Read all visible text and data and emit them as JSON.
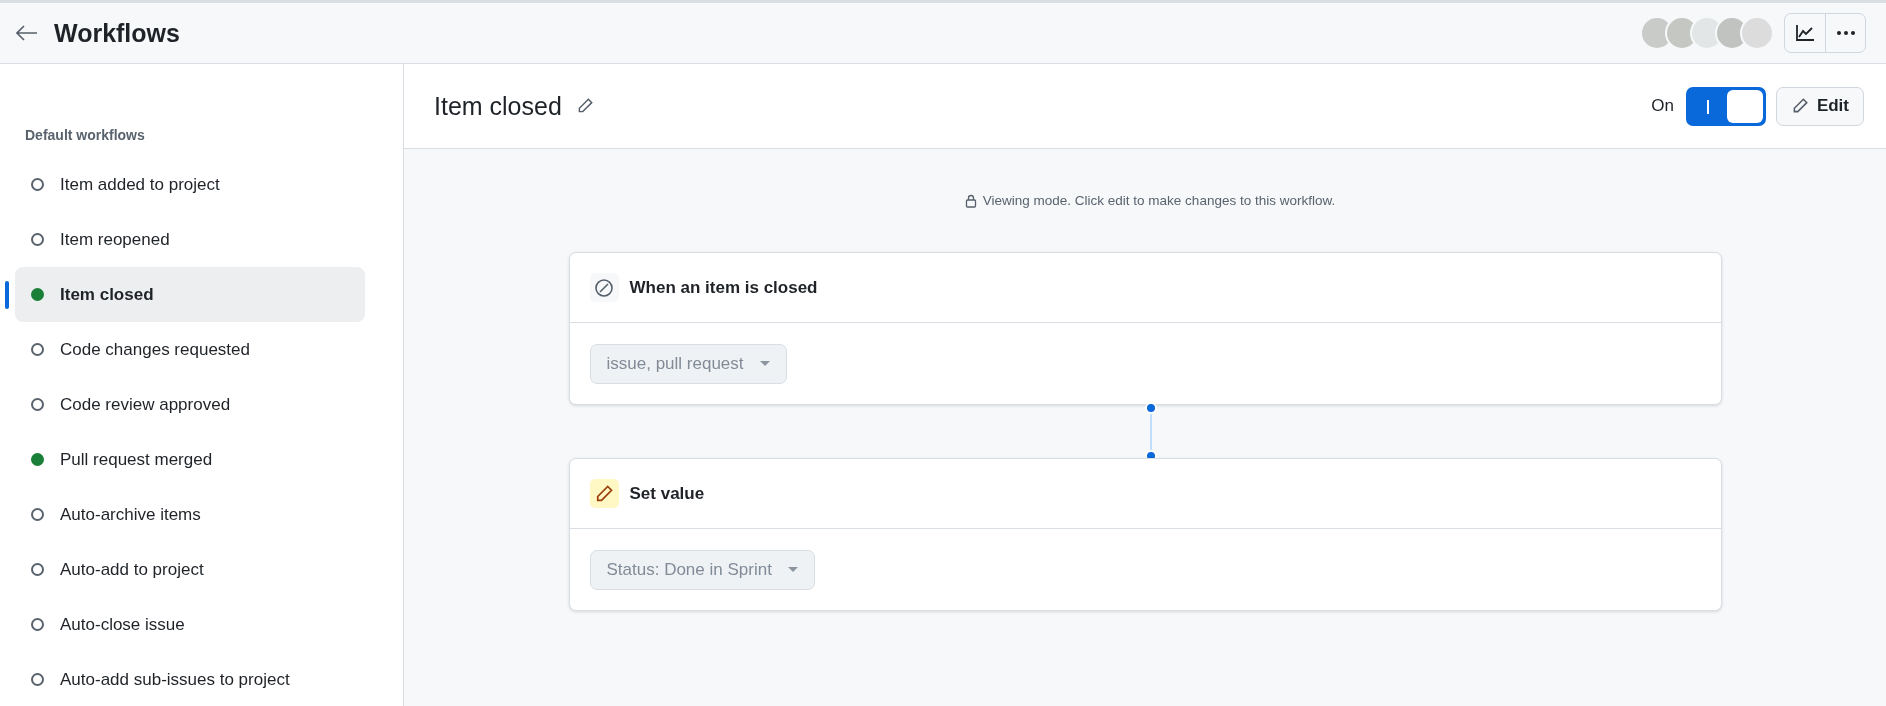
{
  "header": {
    "title": "Workflows"
  },
  "sidebar": {
    "heading": "Default workflows",
    "items": [
      {
        "label": "Item added to project",
        "enabled": false,
        "selected": false
      },
      {
        "label": "Item reopened",
        "enabled": false,
        "selected": false
      },
      {
        "label": "Item closed",
        "enabled": true,
        "selected": true
      },
      {
        "label": "Code changes requested",
        "enabled": false,
        "selected": false
      },
      {
        "label": "Code review approved",
        "enabled": false,
        "selected": false
      },
      {
        "label": "Pull request merged",
        "enabled": true,
        "selected": false
      },
      {
        "label": "Auto-archive items",
        "enabled": false,
        "selected": false
      },
      {
        "label": "Auto-add to project",
        "enabled": false,
        "selected": false
      },
      {
        "label": "Auto-close issue",
        "enabled": false,
        "selected": false
      },
      {
        "label": "Auto-add sub-issues to project",
        "enabled": false,
        "selected": false
      }
    ]
  },
  "workflow": {
    "title": "Item closed",
    "toggle_label": "On",
    "on": true,
    "edit_label": "Edit",
    "notice": "Viewing mode. Click edit to make changes to this workflow.",
    "steps": [
      {
        "kind": "trigger",
        "title": "When an item is closed",
        "value": "issue, pull request"
      },
      {
        "kind": "action",
        "title": "Set value",
        "value": "Status: Done in Sprint"
      }
    ]
  }
}
